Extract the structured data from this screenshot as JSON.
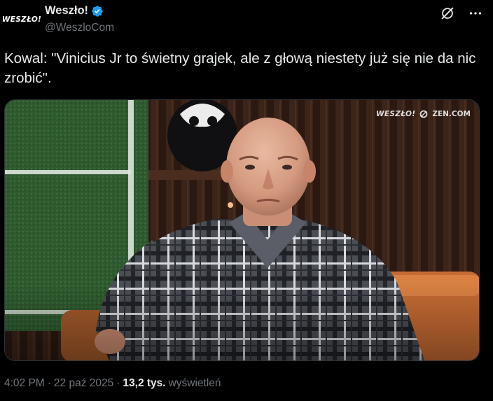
{
  "author": {
    "avatar_text": "WESZŁO!",
    "display_name": "Weszło!",
    "handle": "@WeszloCom"
  },
  "icons": [
    "verified-badge-icon",
    "grok-icon",
    "more-icon"
  ],
  "tweet": {
    "text": "Kowal: \"Vinicius Jr to świetny grajek, ale z głową niestety już się nie da nic zrobić\"."
  },
  "media": {
    "watermark_logo": "WESZŁO!",
    "watermark_partner": "ZEN.COM"
  },
  "meta": {
    "time": "4:02 PM",
    "separator": "·",
    "date": "22 paź 2025",
    "separator2": "·",
    "views_count": "13,2 tys.",
    "views_label": "wyświetleń"
  },
  "colors": {
    "background": "#000000",
    "text_primary": "#e7e9ea",
    "text_secondary": "#71767b",
    "verified_blue": "#1d9bf0"
  }
}
